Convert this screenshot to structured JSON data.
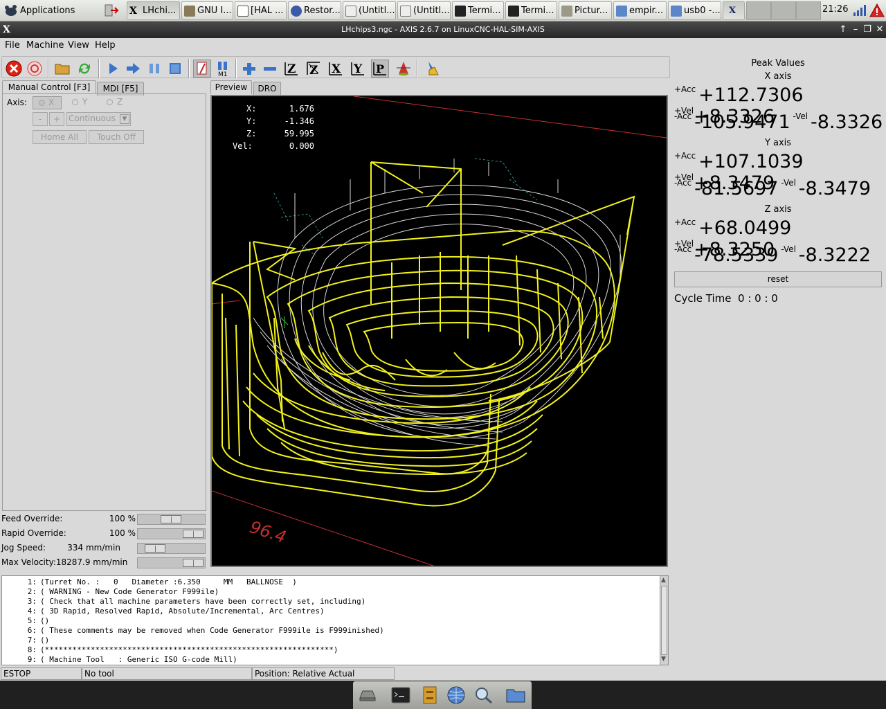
{
  "taskbar": {
    "apps_menu": "Applications Menu",
    "tasks": [
      "LHchi...",
      "GNU I...",
      "[HAL ...",
      "Restor...",
      "(Untitl...",
      "(Untitl...",
      "Termi...",
      "Termi...",
      "Pictur...",
      "empir...",
      "usb0 -..."
    ],
    "clock": "21:26"
  },
  "window": {
    "title": "LHchips3.ngc - AXIS 2.6.7 on LinuxCNC-HAL-SIM-AXIS"
  },
  "menu": {
    "file": "File",
    "machine": "Machine",
    "view": "View",
    "help": "Help"
  },
  "left_tabs": {
    "manual": "Manual Control [F3]",
    "mdi": "MDI [F5]"
  },
  "manual": {
    "axis_label": "Axis:",
    "axes": [
      "X",
      "Y",
      "Z"
    ],
    "minus": "-",
    "plus": "+",
    "jog_mode": "Continuous",
    "home_all": "Home All",
    "touch_off": "Touch Off"
  },
  "overrides": {
    "feed_label": "Feed Override:",
    "feed_value": "100 %",
    "feed_fraction": 0.5,
    "rapid_label": "Rapid Override:",
    "rapid_value": "100 %",
    "rapid_fraction": 1.0,
    "jog_label": "Jog Speed:",
    "jog_value": "334 mm/min",
    "jog_fraction": 0.15,
    "maxvel_label": "Max Velocity:18287.9 mm/min",
    "maxvel_fraction": 1.0
  },
  "preview_tabs": {
    "preview": "Preview",
    "dro": "DRO"
  },
  "dro": {
    "x_label": "X:",
    "x": "1.676",
    "y_label": "Y:",
    "y": "-1.346",
    "z_label": "Z:",
    "z": "59.995",
    "vel_label": "Vel:",
    "vel": "0.000"
  },
  "preview": {
    "dimension_label": "96.4"
  },
  "peak": {
    "title": "Peak Values",
    "axes": [
      {
        "name": "X axis",
        "pacc": "+112.7306",
        "pvel": "+8.3326",
        "nacc": "-105.9471",
        "nvel": "-8.3326"
      },
      {
        "name": "Y axis",
        "pacc": "+107.1039",
        "pvel": "+8.3479",
        "nacc": "-81.5697",
        "nvel": "-8.3479"
      },
      {
        "name": "Z axis",
        "pacc": "+68.0499",
        "pvel": "+8.3250",
        "nacc": "-78.5339",
        "nvel": "-8.3222"
      }
    ],
    "pacc_label": "+Acc",
    "pvel_label": "+Vel",
    "nacc_label": "-Acc",
    "nvel_label": "-Vel",
    "reset": "reset",
    "cycle_time": "Cycle Time  0 : 0 : 0"
  },
  "code": [
    {
      "n": "1:",
      "t": "(Turret No. :   0   Diameter :6.350     MM   BALLNOSE  )"
    },
    {
      "n": "2:",
      "t": "( WARNING - New Code Generator F999ile)"
    },
    {
      "n": "3:",
      "t": "( Check that all machine parameters have been correctly set, including)"
    },
    {
      "n": "4:",
      "t": "( 3D Rapid, Resolved Rapid, Absolute/Incremental, Arc Centres)"
    },
    {
      "n": "5:",
      "t": "()"
    },
    {
      "n": "6:",
      "t": "( These comments may be removed when Code Generator F999ile is F999inished)"
    },
    {
      "n": "7:",
      "t": "()"
    },
    {
      "n": "8:",
      "t": "(***************************************************************)"
    },
    {
      "n": "9:",
      "t": "( Machine Tool   : Generic ISO G-code Mill)"
    }
  ],
  "status": {
    "estop": "ESTOP",
    "tool": "No tool",
    "position": "Position: Relative Actual"
  }
}
